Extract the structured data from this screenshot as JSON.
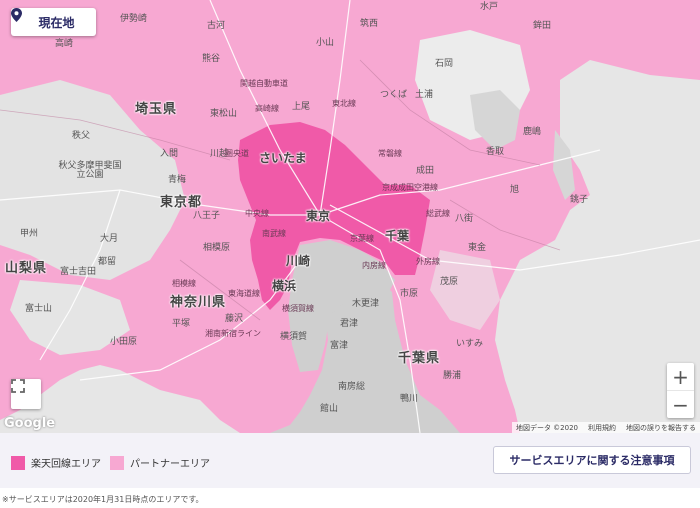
{
  "location_button": {
    "label": "現在地",
    "icon": "map-pin-icon"
  },
  "fullscreen_button": {
    "icon": "fullscreen-icon"
  },
  "zoom": {
    "in_label": "+",
    "out_label": "−"
  },
  "map_provider": "Google",
  "attribution": {
    "map_data": "地図データ ©2020",
    "terms": "利用規約",
    "report": "地図の誤りを報告する"
  },
  "colors": {
    "rakuten_area": "#f05aa8",
    "partner_area": "#f7a8d2",
    "land": "#e8e8e8",
    "sea": "#cfcfcf"
  },
  "map_labels": {
    "prefectures": [
      "埼玉県",
      "東京都",
      "神奈川県",
      "千葉県",
      "山梨県"
    ],
    "cities_major": [
      "さいたま",
      "東京",
      "千葉",
      "川崎",
      "横浜"
    ],
    "places": [
      "伊勢崎",
      "古河",
      "小山",
      "筑西",
      "水戸",
      "上尾",
      "石岡",
      "鉾田",
      "土浦",
      "つくば",
      "鹿嶋",
      "香取",
      "銚子",
      "旭",
      "成田",
      "八街",
      "東金",
      "市原",
      "茂原",
      "いすみ",
      "勝浦",
      "鴨川",
      "館山",
      "南房総",
      "君津",
      "木更津",
      "富津",
      "横須賀",
      "藤沢",
      "平塚",
      "小田原",
      "相模原",
      "八王子",
      "秩父",
      "青梅",
      "甲州",
      "大月",
      "富士吉田",
      "都留",
      "富士山",
      "秋父多摩甲斐国立公園",
      "熊谷",
      "東松山",
      "川越",
      "入間",
      "高崎"
    ],
    "roads": [
      "常磐線",
      "中央線",
      "京成成田空港線",
      "総武線",
      "外房線",
      "内房線",
      "東海道線",
      "横須賀線",
      "南武線",
      "相模線",
      "関越自動車道",
      "圏央道",
      "京葉線",
      "湘南新宿ライン",
      "東北線",
      "高崎線"
    ]
  },
  "legend": {
    "rakuten_label": "楽天回線エリア",
    "partner_label": "パートナーエリア",
    "notice_button": "サービスエリアに関する注意事項"
  },
  "footnote": "※サービスエリアは2020年1月31日時点のエリアです。"
}
